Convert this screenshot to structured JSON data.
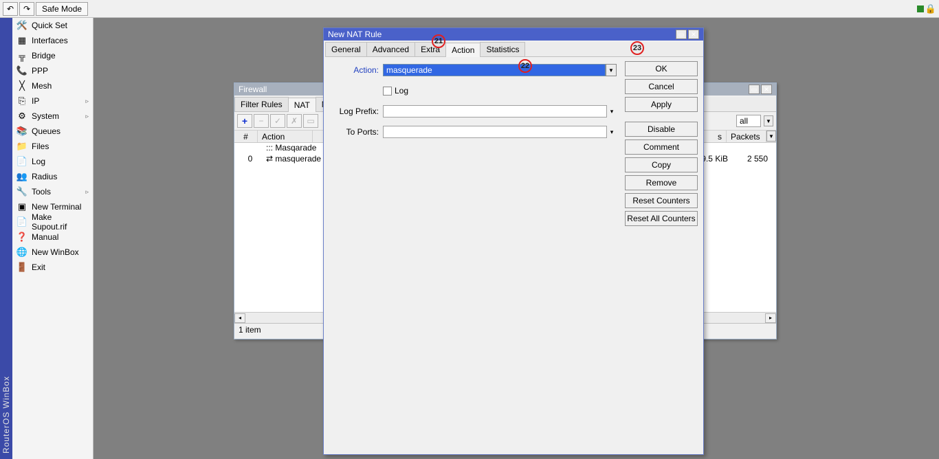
{
  "toolbar": {
    "undo_glyph": "↶",
    "redo_glyph": "↷",
    "safe_mode": "Safe Mode"
  },
  "brand": "RouterOS WinBox",
  "sidebar": {
    "items": [
      {
        "icon": "🛠️",
        "label": "Quick Set",
        "sub": ""
      },
      {
        "icon": "▦",
        "label": "Interfaces",
        "sub": ""
      },
      {
        "icon": "╦",
        "label": "Bridge",
        "sub": ""
      },
      {
        "icon": "📞",
        "label": "PPP",
        "sub": ""
      },
      {
        "icon": "╳",
        "label": "Mesh",
        "sub": ""
      },
      {
        "icon": "⎘",
        "label": "IP",
        "sub": "▹"
      },
      {
        "icon": "⚙",
        "label": "System",
        "sub": "▹"
      },
      {
        "icon": "📚",
        "label": "Queues",
        "sub": ""
      },
      {
        "icon": "📁",
        "label": "Files",
        "sub": ""
      },
      {
        "icon": "📄",
        "label": "Log",
        "sub": ""
      },
      {
        "icon": "👥",
        "label": "Radius",
        "sub": ""
      },
      {
        "icon": "🔧",
        "label": "Tools",
        "sub": "▹"
      },
      {
        "icon": "▣",
        "label": "New Terminal",
        "sub": ""
      },
      {
        "icon": "📄",
        "label": "Make Supout.rif",
        "sub": ""
      },
      {
        "icon": "❓",
        "label": "Manual",
        "sub": ""
      },
      {
        "icon": "🌐",
        "label": "New WinBox",
        "sub": ""
      },
      {
        "icon": "🚪",
        "label": "Exit",
        "sub": ""
      }
    ]
  },
  "firewall": {
    "title": "Firewall",
    "tabs": [
      "Filter Rules",
      "NAT",
      "Mangle"
    ],
    "active_tab": 1,
    "filter_label": "all",
    "columns": {
      "num": "#",
      "action": "Action",
      "bytes_suffix": "s",
      "packets": "Packets"
    },
    "rows": [
      {
        "num": "",
        "action": "::: Masqarade"
      },
      {
        "num": "0",
        "action": "⇄ masquerade"
      }
    ],
    "peek": {
      "bytes": "9.5 KiB",
      "packets": "2 550"
    },
    "status": "1 item"
  },
  "nat": {
    "title": "New NAT Rule",
    "tabs": [
      "General",
      "Advanced",
      "Extra",
      "Action",
      "Statistics"
    ],
    "active_tab": 3,
    "labels": {
      "action": "Action:",
      "log": "Log",
      "log_prefix": "Log Prefix:",
      "to_ports": "To Ports:"
    },
    "action_value": "masquerade",
    "log_prefix_value": "",
    "to_ports_value": "",
    "buttons": [
      "OK",
      "Cancel",
      "Apply",
      "Disable",
      "Comment",
      "Copy",
      "Remove",
      "Reset Counters",
      "Reset All Counters"
    ]
  },
  "callouts": {
    "c21": "21",
    "c22": "22",
    "c23": "23"
  }
}
